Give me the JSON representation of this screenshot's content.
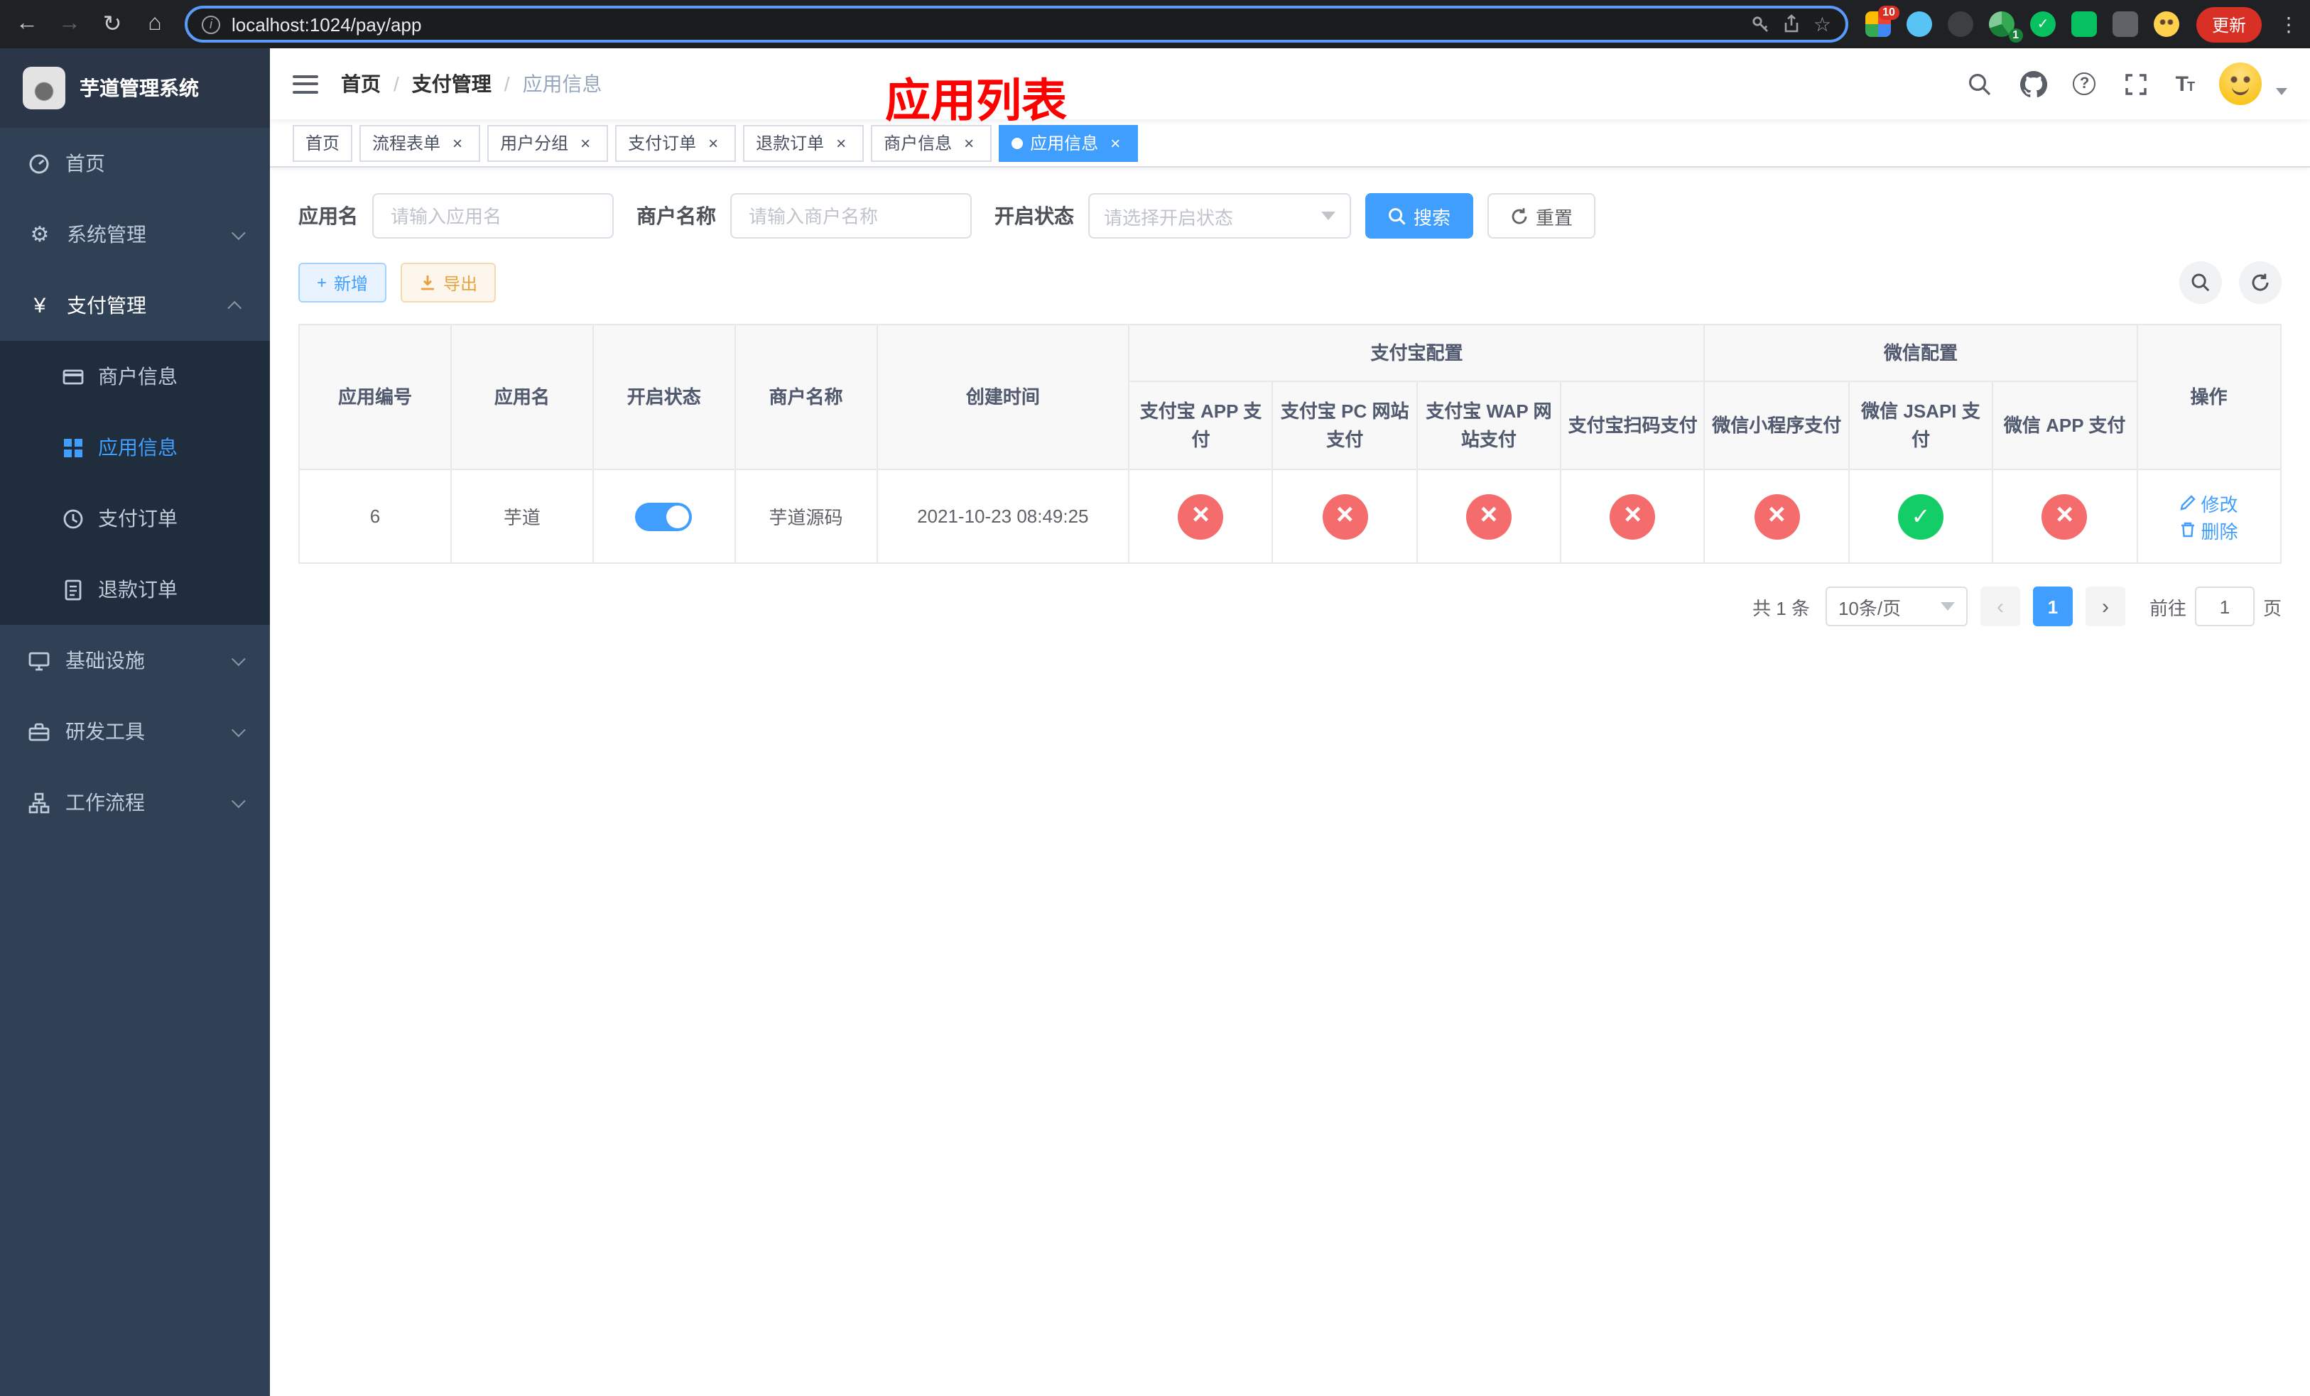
{
  "colors": {
    "accent": "#409eff",
    "danger": "#f56c6c",
    "success": "#13ce66",
    "warning": "#e6a23c",
    "title_red": "#ff0000",
    "sidebar_bg": "#304156",
    "submenu_bg": "#1f2d3d"
  },
  "icons": {
    "back": "←",
    "forward": "→",
    "reload": "↻",
    "home": "⌂",
    "star": "☆",
    "dots": "⋮",
    "gear": "⚙",
    "yen": "¥"
  },
  "browser": {
    "url": "localhost:1024/pay/app",
    "update_label": "更新",
    "ext_badge_red": "10",
    "ext_badge_green": "1"
  },
  "sidebar": {
    "logo_title": "芋道管理系统",
    "items": [
      {
        "label": "首页"
      },
      {
        "label": "系统管理"
      },
      {
        "label": "支付管理",
        "children": [
          {
            "label": "商户信息"
          },
          {
            "label": "应用信息",
            "active": true
          },
          {
            "label": "支付订单"
          },
          {
            "label": "退款订单"
          }
        ]
      },
      {
        "label": "基础设施"
      },
      {
        "label": "研发工具"
      },
      {
        "label": "工作流程"
      }
    ]
  },
  "navbar": {
    "breadcrumb": [
      "首页",
      "支付管理",
      "应用信息"
    ],
    "overlay_title": "应用列表"
  },
  "tags": [
    {
      "label": "首页"
    },
    {
      "label": "流程表单"
    },
    {
      "label": "用户分组"
    },
    {
      "label": "支付订单"
    },
    {
      "label": "退款订单"
    },
    {
      "label": "商户信息"
    },
    {
      "label": "应用信息",
      "active": true
    }
  ],
  "filters": {
    "app_name_label": "应用名",
    "app_name_placeholder": "请输入应用名",
    "merchant_label": "商户名称",
    "merchant_placeholder": "请输入商户名称",
    "status_label": "开启状态",
    "status_placeholder": "请选择开启状态",
    "search_button": "搜索",
    "reset_button": "重置"
  },
  "toolbar": {
    "add_button": "新增",
    "export_button": "导出"
  },
  "table": {
    "group_headers": {
      "alipay": "支付宝配置",
      "wechat": "微信配置"
    },
    "columns": [
      "应用编号",
      "应用名",
      "开启状态",
      "商户名称",
      "创建时间",
      "支付宝 APP 支付",
      "支付宝 PC 网站支付",
      "支付宝 WAP 网站支付",
      "支付宝扫码支付",
      "微信小程序支付",
      "微信 JSAPI 支付",
      "微信 APP 支付",
      "操作"
    ],
    "rows": [
      {
        "id": "6",
        "name": "芋道",
        "status_on": true,
        "merchant": "芋道源码",
        "created_at": "2021-10-23 08:49:25",
        "alipay_app": false,
        "alipay_pc": false,
        "alipay_wap": false,
        "alipay_qr": false,
        "wx_mini": false,
        "wx_jsapi": true,
        "wx_app": false,
        "edit_label": "修改",
        "delete_label": "删除"
      }
    ]
  },
  "pagination": {
    "total_text": "共 1 条",
    "page_size": "10条/页",
    "current_page": "1",
    "goto_label": "前往",
    "goto_value": "1",
    "page_label": "页"
  }
}
